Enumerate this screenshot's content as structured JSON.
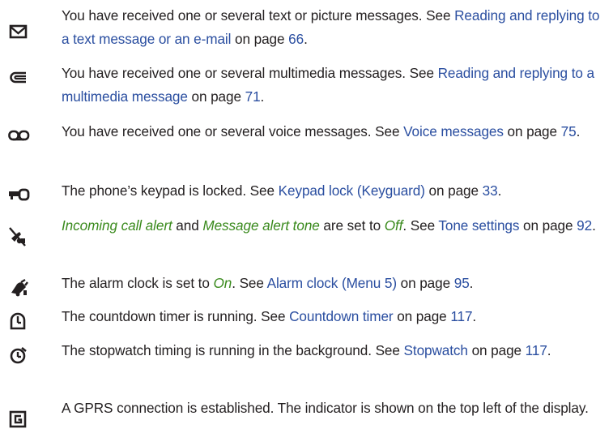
{
  "items": [
    {
      "icon": "envelope-icon",
      "text1": "You have received one or several text or picture messages. See ",
      "link": "Reading and replying to a text message or an e-mail",
      "text2": " on page ",
      "page": "66",
      "text3": "."
    },
    {
      "icon": "multimedia-message-icon",
      "text1": "You have received one or several multimedia messages. See ",
      "link": "Reading and replying to a multimedia message",
      "text2": " on page ",
      "page": "71",
      "text3": "."
    },
    {
      "icon": "voicemail-icon",
      "text1": "You have received one or several voice messages. See ",
      "link": "Voice messages",
      "text2": " on page ",
      "page": "75",
      "text3": "."
    },
    {
      "icon": "key-icon",
      "text1": "The phone’s keypad is locked. See ",
      "link": "Keypad lock (Keyguard)",
      "text2": " on page ",
      "page": "33",
      "text3": "."
    },
    {
      "icon": "silent-mode-icon",
      "em1": "Incoming call alert",
      "t_and": " and ",
      "em2": "Message alert tone",
      "t_set": " are set to ",
      "em3": "Off",
      "text1": ". See ",
      "link": "Tone settings",
      "text2": " on page ",
      "page": "92",
      "text3": "."
    },
    {
      "icon": "alarm-bell-icon",
      "text0": "The alarm clock is set to ",
      "em1": "On",
      "text1": ". See ",
      "link": "Alarm clock (Menu 5)",
      "text2": " on page ",
      "page": "95",
      "text3": "."
    },
    {
      "icon": "countdown-timer-icon",
      "text1": "The countdown timer is running. See ",
      "link": "Countdown timer",
      "text2": " on page ",
      "page": "117",
      "text3": "."
    },
    {
      "icon": "stopwatch-icon",
      "text1": "The stopwatch timing is running in the background. See ",
      "link": "Stopwatch",
      "text2": " on page ",
      "page": "117",
      "text3": "."
    },
    {
      "icon": "gprs-icon",
      "text1": "A GPRS connection is established. The indicator is shown on the top left of the display."
    }
  ],
  "colors": {
    "link": "#2a4ea0",
    "emphasis": "#3a8a1d",
    "text": "#231f20"
  }
}
